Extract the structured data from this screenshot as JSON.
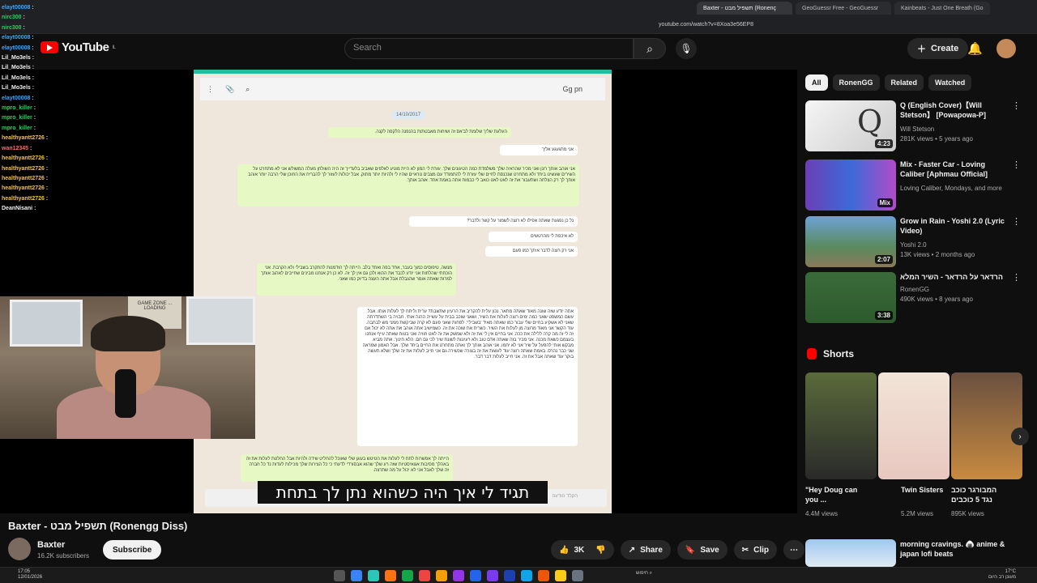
{
  "browser": {
    "tabs": [
      {
        "label": "Baxter - תשפיל מבט (Ronenç",
        "active": true
      },
      {
        "label": "GeoGuessr Free - GeoGuessr",
        "active": false
      },
      {
        "label": "Kainbeats - Just One Breath (Go",
        "active": false
      }
    ],
    "url": "youtube.com/watch?v=8Xoa3e56EP8"
  },
  "youtube": {
    "logo": "YouTube",
    "country_code": "IL",
    "search_placeholder": "Search",
    "create_label": "Create"
  },
  "chat": [
    {
      "name": "elayt00008",
      "msg": "",
      "color": "#3ea6ff"
    },
    {
      "name": "nirc300",
      "msg": "",
      "color": "#1ed760"
    },
    {
      "name": "nirc300",
      "msg": "",
      "color": "#1ed760"
    },
    {
      "name": "elayt00008",
      "msg": "",
      "color": "#3ea6ff"
    },
    {
      "name": "elayt00008",
      "msg": "",
      "color": "#3ea6ff"
    },
    {
      "name": "Lil_Mo3els",
      "msg": "",
      "color": "#f1f1f1"
    },
    {
      "name": "Lil_Mo3els",
      "msg": "",
      "color": "#f1f1f1"
    },
    {
      "name": "Lil_Mo3els",
      "msg": "",
      "color": "#f1f1f1"
    },
    {
      "name": "Lil_Mo3els",
      "msg": "",
      "color": "#f1f1f1"
    },
    {
      "name": "elayt00008",
      "msg": "",
      "color": "#3ea6ff"
    },
    {
      "name": "mpro_killer",
      "msg": "",
      "color": "#1ed760"
    },
    {
      "name": "mpro_killer",
      "msg": "",
      "color": "#1ed760"
    },
    {
      "name": "mpro_killer",
      "msg": "",
      "color": "#1ed760"
    },
    {
      "name": "healthyantt2726",
      "msg": "",
      "color": "#f4c542"
    },
    {
      "name": "wan12345",
      "msg": "",
      "color": "#ff6b6b"
    },
    {
      "name": "healthyantt2726",
      "msg": "",
      "color": "#f4c542"
    },
    {
      "name": "healthyantt2726",
      "msg": "",
      "color": "#f4c542"
    },
    {
      "name": "healthyantt2726",
      "msg": "",
      "color": "#f4c542"
    },
    {
      "name": "healthyantt2726",
      "msg": "",
      "color": "#f4c542"
    },
    {
      "name": "healthyantt2726",
      "msg": "",
      "color": "#f4c542"
    },
    {
      "name": "DeanNisani",
      "msg": "",
      "color": "#f1f1f1"
    }
  ],
  "document": {
    "contact": "Gg pn",
    "date": "14/10/2017",
    "poster_text": "GAME ZONE ... LOADING",
    "bubbles": [
      "העלעת שליך שלומת לב'אס זה ושיחות מאבטתות בהנפנה הלקפה לקנה.",
      "אני מתגעגע אליך",
      "אני אוהב אותך רונן ואני מכיר שהראיה שלך משלמדת כמה הטיגונים שלך. עזרת לי המון לא היית מוניע לאלפים שאביב בלעדייך זה היה השולחן מעלה המשולש אני לא מתחרט על השירים שעשינו ביחד ולא מתחרט שנכנסת לחיים שלי עזרת לי להתמודד עם מצבים נוראיים שהיו לי ולהיות יותר מתוק. אבל יכולות לעזור לך להבריח את החוכן שלי הרבה יותר אוהב אותך לך רק הצלחה ושתעבור את זה לאט לאט כואב לי כבמוח אתה באמת אחד. אוהב אותך.",
      "נל כן נפגעת שאתה אפילו לא רוצה לשמור על קשר ולדבר?",
      "לא איכפת לי מהרטשים",
      "אני רק רוצה לדבר איתך כמו פעם",
      "מנשה, טיפוסים כמוך בעבר, אחד בפה ואחד בלב. הייתה לך הזדמנות להתקרב בשבילי ולא הקרבת. אני הוכחתי שהלחות אני יודע לכבד את ההוא ולכן גם אין לך זה. לא כן רק אנחנו מבינים שחייבים לאהוב אותך למרות שאתה אומר שהגבלת אבל אתה העצה בדיוק כמו שאני.",
      "אתה יודע שזה שונה מאוד שאתה מתאר. נכון עלית להקריב את הרעיון שתשבת? ערית וליתח לך לעלות אותו. אבל עשם המשפט שאני כמה ימים רוצה לעלות את השיר, ושאני שוכב בבית על עשייה הרגה אותי. חבויה בי השתדרתה שאני לא אשקיע בחיים שלי עבור כמו שאתה מאיד 'בשבילי'. לפחות שאני פעם לא קרה שביקשת ממני מש לבתבה. עוד הקשר אני מאוד מרוצה מן לעלות את השיר. כשרית את שוכה את זה. כשמישיב אתה אוהב את אתה לא יכול אם זה לי זה מה קרה ללילה את ככה. אני בחיים אין לי את זה ולא שמשק את זה לאט חוויה ואני בטוח שאתה עייף אנחנו בעצמם כשאת מכנה. אני מכיר בזה שאתה אדם טוב ולא רעיונות לשונת שיר לכי גם חם. הלא חינוך. אתה מביא מבקש אותי להפעל על שיר אני לא יחמו. אני אוהב אותך לך ואתה מתחרט את החיים ביחד שלך. אבל האמון שמראה שני כבר נהרס. באמת שאתה רוצה עוד לעשות את זה בצורה שכשירה גם אני חייב לעלות את זה שלך ושלא תעשה בוקר עוד שאתה אבל את זה. אני חייב לעלות דבר דבר.",
      "הייתה לך אפשרות לתת לי לעלות את הטיטש בעוגן שלי שאוכל להחליט שידה ולהיות אבל החלטת לעלות את זה באהלך מסיבות אגואיסטיות שזה רע שלך שהוא אבסורדי לדעתי כי כל הצירות שלך מכילות לעדות נד כל חברה זה שלך לאבל אני לא יכול על מה שתרצה."
    ],
    "composer_placeholder": "הקלד הודעה"
  },
  "subtitle": "תגיד לי איך היה כשהוא נתן לך בתחת",
  "video": {
    "title": "Baxter - תשפיל מבט (Ronengg Diss)",
    "channel": "Baxter",
    "subscribers": "16.2K subscribers",
    "subscribe_label": "Subscribe",
    "likes": "3K",
    "share_label": "Share",
    "save_label": "Save",
    "clip_label": "Clip"
  },
  "chips": [
    {
      "label": "All",
      "active": true
    },
    {
      "label": "RonenGG",
      "active": false
    },
    {
      "label": "Related",
      "active": false
    },
    {
      "label": "Watched",
      "active": false
    }
  ],
  "recommendations": [
    {
      "title": "Q (English Cover)【Will Stetson】 [Powapowa-P]",
      "channel": "Will Stetson",
      "meta": "281K views • 5 years ago",
      "duration": "4:23"
    },
    {
      "title": "Mix - Faster Car - Loving Caliber [Aphmau Official]",
      "channel": "Loving Caliber, Mondays, and more",
      "meta": "",
      "duration": "Mix"
    },
    {
      "title": "Grow in Rain - Yoshi 2.0 (Lyric Video)",
      "channel": "Yoshi 2.0",
      "meta": "13K views • 2 months ago",
      "duration": "2:07"
    },
    {
      "title": "הרדאר על הרדאר - השיר המלא",
      "channel": "RonenGG",
      "meta": "490K views • 8 years ago",
      "duration": "3:38"
    }
  ],
  "shorts_heading": "Shorts",
  "shorts": [
    {
      "title": "\"Hey Doug can you ...",
      "views": "4.4M views"
    },
    {
      "title": "Twin Sisters",
      "views": "5.2M views"
    },
    {
      "title": "המבורגר כוכב נגד 5 כוכבים",
      "views": "895K views"
    }
  ],
  "rec_bottom": {
    "title": "morning cravings. 🍙 anime & japan lofi beats"
  },
  "taskbar": {
    "time": "17:05",
    "date": "12/01/2026",
    "weather_temp": "17°C",
    "weather_desc": "מעונן רב היום",
    "search_label": "חיפוש"
  }
}
